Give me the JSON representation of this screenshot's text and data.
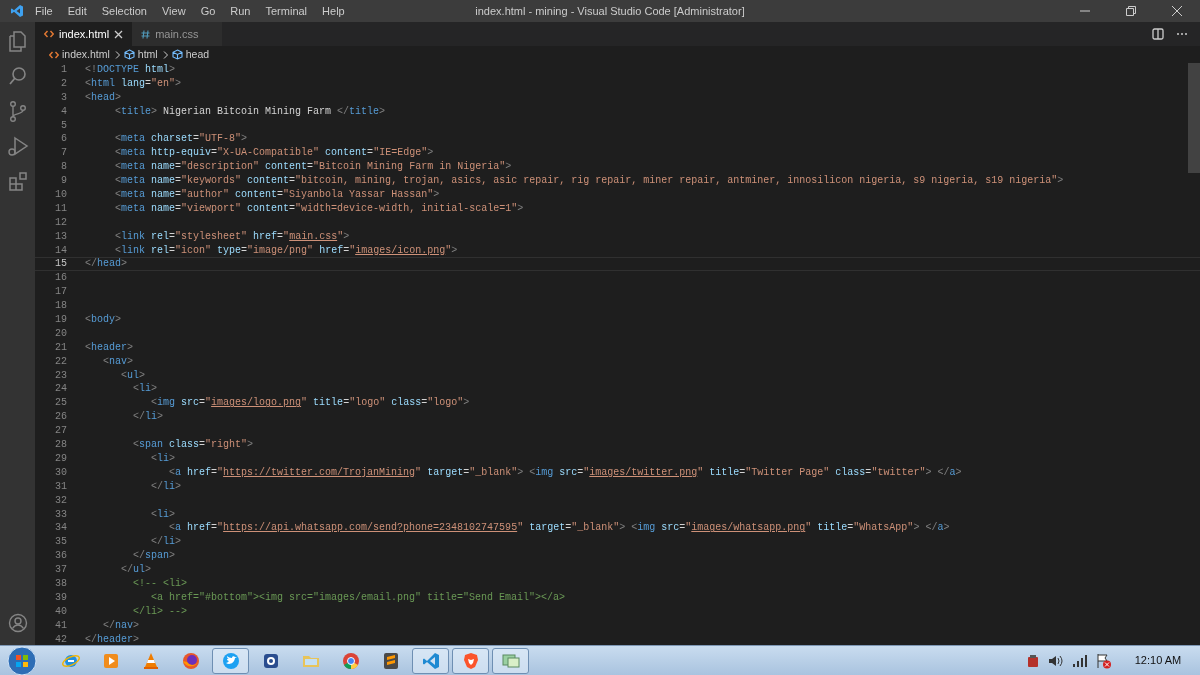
{
  "window": {
    "title": "index.html - mining - Visual Studio Code [Administrator]"
  },
  "menu": [
    "File",
    "Edit",
    "Selection",
    "View",
    "Go",
    "Run",
    "Terminal",
    "Help"
  ],
  "activity_bar": [
    {
      "kind": "files",
      "selected": false
    },
    {
      "kind": "search",
      "selected": false
    },
    {
      "kind": "source-control",
      "selected": false
    },
    {
      "kind": "run",
      "selected": false
    },
    {
      "kind": "extensions",
      "selected": false
    }
  ],
  "tabs": [
    {
      "label": "index.html",
      "kind": "html",
      "selected": true
    },
    {
      "label": "main.css",
      "kind": "css",
      "selected": false
    }
  ],
  "breadcrumb": [
    {
      "label": "index.html",
      "kind": "file"
    },
    {
      "label": "html",
      "kind": "element"
    },
    {
      "label": "head",
      "kind": "element"
    }
  ],
  "lines": [
    {
      "number": "1",
      "current": false,
      "tokens": [
        {
          "kind": "punct",
          "text": "<!"
        },
        {
          "kind": "tag",
          "text": "DOCTYPE"
        },
        {
          "kind": "attr",
          "text": " html"
        },
        {
          "kind": "punct",
          "text": ">"
        }
      ]
    },
    {
      "number": "2",
      "current": false,
      "tokens": [
        {
          "kind": "punct",
          "text": "<"
        },
        {
          "kind": "tag",
          "text": "html"
        },
        {
          "kind": "attr",
          "text": " lang"
        },
        {
          "kind": "text",
          "text": "="
        },
        {
          "kind": "string",
          "text": "\"en\""
        },
        {
          "kind": "punct",
          "text": ">"
        }
      ]
    },
    {
      "number": "3",
      "current": false,
      "tokens": [
        {
          "kind": "punct",
          "text": "<"
        },
        {
          "kind": "tag",
          "text": "head"
        },
        {
          "kind": "punct",
          "text": ">"
        }
      ]
    },
    {
      "number": "4",
      "current": false,
      "tokens": [
        {
          "kind": "punct",
          "text": "     <"
        },
        {
          "kind": "tag",
          "text": "title"
        },
        {
          "kind": "punct",
          "text": ">"
        },
        {
          "kind": "text",
          "text": " Nigerian Bitcoin Mining Farm "
        },
        {
          "kind": "punct",
          "text": "</"
        },
        {
          "kind": "tag",
          "text": "title"
        },
        {
          "kind": "punct",
          "text": ">"
        }
      ]
    },
    {
      "number": "5",
      "current": false
    },
    {
      "number": "6",
      "current": false,
      "tokens": [
        {
          "kind": "punct",
          "text": "     <"
        },
        {
          "kind": "tag",
          "text": "meta"
        },
        {
          "kind": "attr",
          "text": " charset"
        },
        {
          "kind": "text",
          "text": "="
        },
        {
          "kind": "string",
          "text": "\"UTF-8\""
        },
        {
          "kind": "punct",
          "text": ">"
        }
      ]
    },
    {
      "number": "7",
      "current": false,
      "tokens": [
        {
          "kind": "punct",
          "text": "     <"
        },
        {
          "kind": "tag",
          "text": "meta"
        },
        {
          "kind": "attr",
          "text": " http-equiv"
        },
        {
          "kind": "text",
          "text": "="
        },
        {
          "kind": "string",
          "text": "\"X-UA-Compatible\""
        },
        {
          "kind": "attr",
          "text": " content"
        },
        {
          "kind": "text",
          "text": "="
        },
        {
          "kind": "string",
          "text": "\"IE=Edge\""
        },
        {
          "kind": "punct",
          "text": ">"
        }
      ]
    },
    {
      "number": "8",
      "current": false,
      "tokens": [
        {
          "kind": "punct",
          "text": "     <"
        },
        {
          "kind": "tag",
          "text": "meta"
        },
        {
          "kind": "attr",
          "text": " name"
        },
        {
          "kind": "text",
          "text": "="
        },
        {
          "kind": "string",
          "text": "\"description\""
        },
        {
          "kind": "attr",
          "text": " content"
        },
        {
          "kind": "text",
          "text": "="
        },
        {
          "kind": "string",
          "text": "\"Bitcoin Mining Farm in Nigeria\""
        },
        {
          "kind": "punct",
          "text": ">"
        }
      ]
    },
    {
      "number": "9",
      "current": false,
      "tokens": [
        {
          "kind": "punct",
          "text": "     <"
        },
        {
          "kind": "tag",
          "text": "meta"
        },
        {
          "kind": "attr",
          "text": " name"
        },
        {
          "kind": "text",
          "text": "="
        },
        {
          "kind": "string",
          "text": "\"keywords\""
        },
        {
          "kind": "attr",
          "text": " content"
        },
        {
          "kind": "text",
          "text": "="
        },
        {
          "kind": "string",
          "text": "\"bitcoin, mining, trojan, asics, asic repair, rig repair, miner repair, antminer, innosilicon nigeria, s9 nigeria, s19 nigeria\""
        },
        {
          "kind": "punct",
          "text": ">"
        }
      ]
    },
    {
      "number": "10",
      "current": false,
      "tokens": [
        {
          "kind": "punct",
          "text": "     <"
        },
        {
          "kind": "tag",
          "text": "meta"
        },
        {
          "kind": "attr",
          "text": " name"
        },
        {
          "kind": "text",
          "text": "="
        },
        {
          "kind": "string",
          "text": "\"author\""
        },
        {
          "kind": "attr",
          "text": " content"
        },
        {
          "kind": "text",
          "text": "="
        },
        {
          "kind": "string",
          "text": "\"Siyanbola Yassar Hassan\""
        },
        {
          "kind": "punct",
          "text": ">"
        }
      ]
    },
    {
      "number": "11",
      "current": false,
      "tokens": [
        {
          "kind": "punct",
          "text": "     <"
        },
        {
          "kind": "tag",
          "text": "meta"
        },
        {
          "kind": "attr",
          "text": " name"
        },
        {
          "kind": "text",
          "text": "="
        },
        {
          "kind": "string",
          "text": "\"viewport\""
        },
        {
          "kind": "attr",
          "text": " content"
        },
        {
          "kind": "text",
          "text": "="
        },
        {
          "kind": "string",
          "text": "\"width=device-width, initial-scale=1\""
        },
        {
          "kind": "punct",
          "text": ">"
        }
      ]
    },
    {
      "number": "12",
      "current": false
    },
    {
      "number": "13",
      "current": false,
      "tokens": [
        {
          "kind": "punct",
          "text": "     <"
        },
        {
          "kind": "tag",
          "text": "link"
        },
        {
          "kind": "attr",
          "text": " rel"
        },
        {
          "kind": "text",
          "text": "="
        },
        {
          "kind": "string",
          "text": "\"stylesheet\""
        },
        {
          "kind": "attr",
          "text": " href"
        },
        {
          "kind": "text",
          "text": "="
        },
        {
          "kind": "string",
          "text": "\""
        },
        {
          "kind": "link",
          "text": "main.css"
        },
        {
          "kind": "string",
          "text": "\""
        },
        {
          "kind": "punct",
          "text": ">"
        }
      ]
    },
    {
      "number": "14",
      "current": false,
      "tokens": [
        {
          "kind": "punct",
          "text": "     <"
        },
        {
          "kind": "tag",
          "text": "link"
        },
        {
          "kind": "attr",
          "text": " rel"
        },
        {
          "kind": "text",
          "text": "="
        },
        {
          "kind": "string",
          "text": "\"icon\""
        },
        {
          "kind": "attr",
          "text": " type"
        },
        {
          "kind": "text",
          "text": "="
        },
        {
          "kind": "string",
          "text": "\"image/png\""
        },
        {
          "kind": "attr",
          "text": " href"
        },
        {
          "kind": "text",
          "text": "="
        },
        {
          "kind": "string",
          "text": "\""
        },
        {
          "kind": "link",
          "text": "images/icon.png"
        },
        {
          "kind": "string",
          "text": "\""
        },
        {
          "kind": "punct",
          "text": ">"
        }
      ]
    },
    {
      "number": "15",
      "current": true,
      "tokens": [
        {
          "kind": "punct",
          "text": "</"
        },
        {
          "kind": "tag",
          "text": "head"
        },
        {
          "kind": "punct",
          "text": ">"
        }
      ]
    },
    {
      "number": "16",
      "current": false
    },
    {
      "number": "17",
      "current": false
    },
    {
      "number": "18",
      "current": false
    },
    {
      "number": "19",
      "current": false,
      "tokens": [
        {
          "kind": "punct",
          "text": "<"
        },
        {
          "kind": "tag",
          "text": "body"
        },
        {
          "kind": "punct",
          "text": ">"
        }
      ]
    },
    {
      "number": "20",
      "current": false
    },
    {
      "number": "21",
      "current": false,
      "tokens": [
        {
          "kind": "punct",
          "text": "<"
        },
        {
          "kind": "tag",
          "text": "header"
        },
        {
          "kind": "punct",
          "text": ">"
        }
      ]
    },
    {
      "number": "22",
      "current": false,
      "tokens": [
        {
          "kind": "punct",
          "text": "   <"
        },
        {
          "kind": "tag",
          "text": "nav"
        },
        {
          "kind": "punct",
          "text": ">"
        }
      ]
    },
    {
      "number": "23",
      "current": false,
      "tokens": [
        {
          "kind": "punct",
          "text": "      <"
        },
        {
          "kind": "tag",
          "text": "ul"
        },
        {
          "kind": "punct",
          "text": ">"
        }
      ]
    },
    {
      "number": "24",
      "current": false,
      "tokens": [
        {
          "kind": "punct",
          "text": "        <"
        },
        {
          "kind": "tag",
          "text": "li"
        },
        {
          "kind": "punct",
          "text": ">"
        }
      ]
    },
    {
      "number": "25",
      "current": false,
      "tokens": [
        {
          "kind": "punct",
          "text": "           <"
        },
        {
          "kind": "tag",
          "text": "img"
        },
        {
          "kind": "attr",
          "text": " src"
        },
        {
          "kind": "text",
          "text": "="
        },
        {
          "kind": "string",
          "text": "\""
        },
        {
          "kind": "link",
          "text": "images/logo.png"
        },
        {
          "kind": "string",
          "text": "\""
        },
        {
          "kind": "attr",
          "text": " title"
        },
        {
          "kind": "text",
          "text": "="
        },
        {
          "kind": "string",
          "text": "\"logo\""
        },
        {
          "kind": "attr",
          "text": " class"
        },
        {
          "kind": "text",
          "text": "="
        },
        {
          "kind": "string",
          "text": "\"logo\""
        },
        {
          "kind": "punct",
          "text": ">"
        }
      ]
    },
    {
      "number": "26",
      "current": false,
      "tokens": [
        {
          "kind": "punct",
          "text": "        </"
        },
        {
          "kind": "tag",
          "text": "li"
        },
        {
          "kind": "punct",
          "text": ">"
        }
      ]
    },
    {
      "number": "27",
      "current": false
    },
    {
      "number": "28",
      "current": false,
      "tokens": [
        {
          "kind": "punct",
          "text": "        <"
        },
        {
          "kind": "tag",
          "text": "span"
        },
        {
          "kind": "attr",
          "text": " class"
        },
        {
          "kind": "text",
          "text": "="
        },
        {
          "kind": "string",
          "text": "\"right\""
        },
        {
          "kind": "punct",
          "text": ">"
        }
      ]
    },
    {
      "number": "29",
      "current": false,
      "tokens": [
        {
          "kind": "punct",
          "text": "           <"
        },
        {
          "kind": "tag",
          "text": "li"
        },
        {
          "kind": "punct",
          "text": ">"
        }
      ]
    },
    {
      "number": "30",
      "current": false,
      "tokens": [
        {
          "kind": "punct",
          "text": "              <"
        },
        {
          "kind": "tag",
          "text": "a"
        },
        {
          "kind": "attr",
          "text": " href"
        },
        {
          "kind": "text",
          "text": "="
        },
        {
          "kind": "string",
          "text": "\""
        },
        {
          "kind": "link",
          "text": "https://twitter.com/TrojanMining"
        },
        {
          "kind": "string",
          "text": "\""
        },
        {
          "kind": "attr",
          "text": " target"
        },
        {
          "kind": "text",
          "text": "="
        },
        {
          "kind": "string",
          "text": "\"_blank\""
        },
        {
          "kind": "punct",
          "text": "> <"
        },
        {
          "kind": "tag",
          "text": "img"
        },
        {
          "kind": "attr",
          "text": " src"
        },
        {
          "kind": "text",
          "text": "="
        },
        {
          "kind": "string",
          "text": "\""
        },
        {
          "kind": "link",
          "text": "images/twitter.png"
        },
        {
          "kind": "string",
          "text": "\""
        },
        {
          "kind": "attr",
          "text": " title"
        },
        {
          "kind": "text",
          "text": "="
        },
        {
          "kind": "string",
          "text": "\"Twitter Page\""
        },
        {
          "kind": "attr",
          "text": " class"
        },
        {
          "kind": "text",
          "text": "="
        },
        {
          "kind": "string",
          "text": "\"twitter\""
        },
        {
          "kind": "punct",
          "text": "> </"
        },
        {
          "kind": "tag",
          "text": "a"
        },
        {
          "kind": "punct",
          "text": ">"
        }
      ]
    },
    {
      "number": "31",
      "current": false,
      "tokens": [
        {
          "kind": "punct",
          "text": "           </"
        },
        {
          "kind": "tag",
          "text": "li"
        },
        {
          "kind": "punct",
          "text": ">"
        }
      ]
    },
    {
      "number": "32",
      "current": false
    },
    {
      "number": "33",
      "current": false,
      "tokens": [
        {
          "kind": "punct",
          "text": "           <"
        },
        {
          "kind": "tag",
          "text": "li"
        },
        {
          "kind": "punct",
          "text": ">"
        }
      ]
    },
    {
      "number": "34",
      "current": false,
      "tokens": [
        {
          "kind": "punct",
          "text": "              <"
        },
        {
          "kind": "tag",
          "text": "a"
        },
        {
          "kind": "attr",
          "text": " href"
        },
        {
          "kind": "text",
          "text": "="
        },
        {
          "kind": "string",
          "text": "\""
        },
        {
          "kind": "link",
          "text": "https://api.whatsapp.com/send?phone=2348102747595"
        },
        {
          "kind": "string",
          "text": "\""
        },
        {
          "kind": "attr",
          "text": " target"
        },
        {
          "kind": "text",
          "text": "="
        },
        {
          "kind": "string",
          "text": "\"_blank\""
        },
        {
          "kind": "punct",
          "text": "> <"
        },
        {
          "kind": "tag",
          "text": "img"
        },
        {
          "kind": "attr",
          "text": " src"
        },
        {
          "kind": "text",
          "text": "="
        },
        {
          "kind": "string",
          "text": "\""
        },
        {
          "kind": "link",
          "text": "images/whatsapp.png"
        },
        {
          "kind": "string",
          "text": "\""
        },
        {
          "kind": "attr",
          "text": " title"
        },
        {
          "kind": "text",
          "text": "="
        },
        {
          "kind": "string",
          "text": "\"WhatsApp\""
        },
        {
          "kind": "punct",
          "text": "> </"
        },
        {
          "kind": "tag",
          "text": "a"
        },
        {
          "kind": "punct",
          "text": ">"
        }
      ]
    },
    {
      "number": "35",
      "current": false,
      "tokens": [
        {
          "kind": "punct",
          "text": "           </"
        },
        {
          "kind": "tag",
          "text": "li"
        },
        {
          "kind": "punct",
          "text": ">"
        }
      ]
    },
    {
      "number": "36",
      "current": false,
      "tokens": [
        {
          "kind": "punct",
          "text": "        </"
        },
        {
          "kind": "tag",
          "text": "span"
        },
        {
          "kind": "punct",
          "text": ">"
        }
      ]
    },
    {
      "number": "37",
      "current": false,
      "tokens": [
        {
          "kind": "punct",
          "text": "      </"
        },
        {
          "kind": "tag",
          "text": "ul"
        },
        {
          "kind": "punct",
          "text": ">"
        }
      ]
    },
    {
      "number": "38",
      "current": false,
      "tokens": [
        {
          "kind": "comment",
          "text": "        <!-- <li>"
        }
      ]
    },
    {
      "number": "39",
      "current": false,
      "tokens": [
        {
          "kind": "comment",
          "text": "           <a href=\"#bottom\"><img src=\"images/email.png\" title=\"Send Email\"></a>"
        }
      ]
    },
    {
      "number": "40",
      "current": false,
      "tokens": [
        {
          "kind": "comment",
          "text": "        </li> -->"
        }
      ]
    },
    {
      "number": "41",
      "current": false,
      "tokens": [
        {
          "kind": "punct",
          "text": "   </"
        },
        {
          "kind": "tag",
          "text": "nav"
        },
        {
          "kind": "punct",
          "text": ">"
        }
      ]
    },
    {
      "number": "42",
      "current": false,
      "tokens": [
        {
          "kind": "punct",
          "text": "</"
        },
        {
          "kind": "tag",
          "text": "header"
        },
        {
          "kind": "punct",
          "text": ">"
        }
      ]
    }
  ],
  "taskbar": [
    {
      "kind": "ie",
      "running": false
    },
    {
      "kind": "media",
      "running": false
    },
    {
      "kind": "cone",
      "running": false
    },
    {
      "kind": "fox",
      "running": false
    },
    {
      "kind": "bird",
      "running": true
    },
    {
      "kind": "app",
      "running": false
    },
    {
      "kind": "folder",
      "running": false
    },
    {
      "kind": "chrome",
      "running": false
    },
    {
      "kind": "sublime",
      "running": false
    },
    {
      "kind": "vscode",
      "running": true
    },
    {
      "kind": "shield",
      "running": true
    },
    {
      "kind": "window",
      "running": true
    }
  ],
  "tray": {
    "clock": "12:10 AM"
  }
}
